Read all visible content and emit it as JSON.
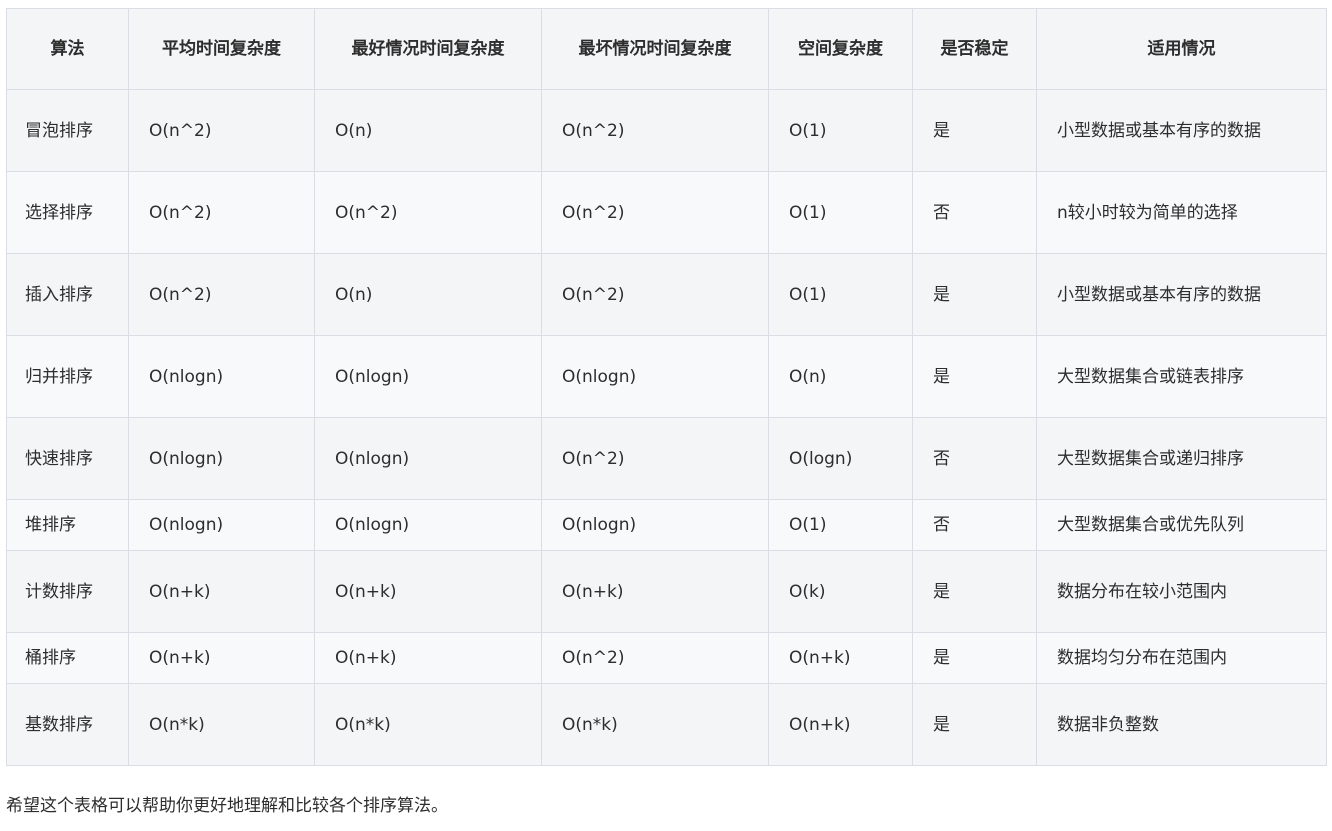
{
  "table": {
    "headers": [
      "算法",
      "平均时间复杂度",
      "最好情况时间复杂度",
      "最坏情况时间复杂度",
      "空间复杂度",
      "是否稳定",
      "适用情况"
    ],
    "rows": [
      [
        "冒泡排序",
        "O(n^2)",
        "O(n)",
        "O(n^2)",
        "O(1)",
        "是",
        "小型数据或基本有序的数据"
      ],
      [
        "选择排序",
        "O(n^2)",
        "O(n^2)",
        "O(n^2)",
        "O(1)",
        "否",
        "n较小时较为简单的选择"
      ],
      [
        "插入排序",
        "O(n^2)",
        "O(n)",
        "O(n^2)",
        "O(1)",
        "是",
        "小型数据或基本有序的数据"
      ],
      [
        "归并排序",
        "O(nlogn)",
        "O(nlogn)",
        "O(nlogn)",
        "O(n)",
        "是",
        "大型数据集合或链表排序"
      ],
      [
        "快速排序",
        "O(nlogn)",
        "O(nlogn)",
        "O(n^2)",
        "O(logn)",
        "否",
        "大型数据集合或递归排序"
      ],
      [
        "堆排序",
        "O(nlogn)",
        "O(nlogn)",
        "O(nlogn)",
        "O(1)",
        "否",
        "大型数据集合或优先队列"
      ],
      [
        "计数排序",
        "O(n+k)",
        "O(n+k)",
        "O(n+k)",
        "O(k)",
        "是",
        "数据分布在较小范围内"
      ],
      [
        "桶排序",
        "O(n+k)",
        "O(n+k)",
        "O(n^2)",
        "O(n+k)",
        "是",
        "数据均匀分布在范围内"
      ],
      [
        "基数排序",
        "O(n*k)",
        "O(n*k)",
        "O(n*k)",
        "O(n+k)",
        "是",
        "数据非负整数"
      ]
    ]
  },
  "footer": {
    "note": "希望这个表格可以帮助你更好地理解和比较各个排序算法。"
  }
}
